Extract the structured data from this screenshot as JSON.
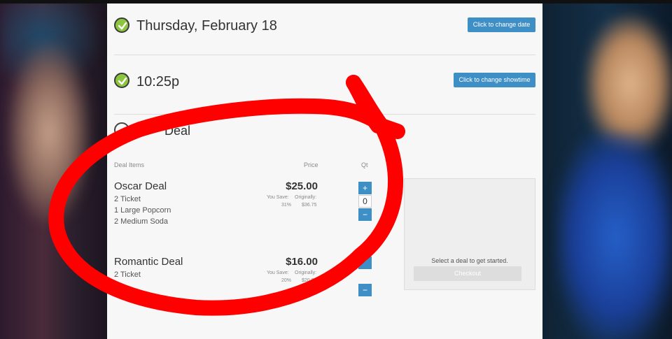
{
  "date_step": {
    "title": "Thursday, February 18",
    "button": "Click to change date"
  },
  "time_step": {
    "title": "10:25p",
    "button": "Click to change showtime"
  },
  "deal_step": {
    "title": "Deal"
  },
  "columns": {
    "items": "Deal Items",
    "price": "Price",
    "qty": "Qt"
  },
  "deals": [
    {
      "name": "Oscar Deal",
      "items": [
        "2 Ticket",
        "1 Large Popcorn",
        "2 Medium Soda"
      ],
      "price": "$25.00",
      "you_save_label": "You Save:",
      "you_save": "31%",
      "originally_label": "Originally:",
      "originally": "$36.75",
      "qty_plus": "+",
      "qty": "0",
      "qty_minus": "−"
    },
    {
      "name": "Romantic Deal",
      "items": [
        "2 Ticket"
      ],
      "price": "$16.00",
      "you_save_label": "You Save:",
      "you_save": "20%",
      "originally_label": "Originally:",
      "originally": "$20.00",
      "qty_minus": "−"
    }
  ],
  "cart": {
    "message": "Select a deal to get started.",
    "checkout": "Checkout"
  },
  "colors": {
    "accent": "#3f8fc7",
    "check": "#8cc63f",
    "annotation": "#ff0000"
  }
}
